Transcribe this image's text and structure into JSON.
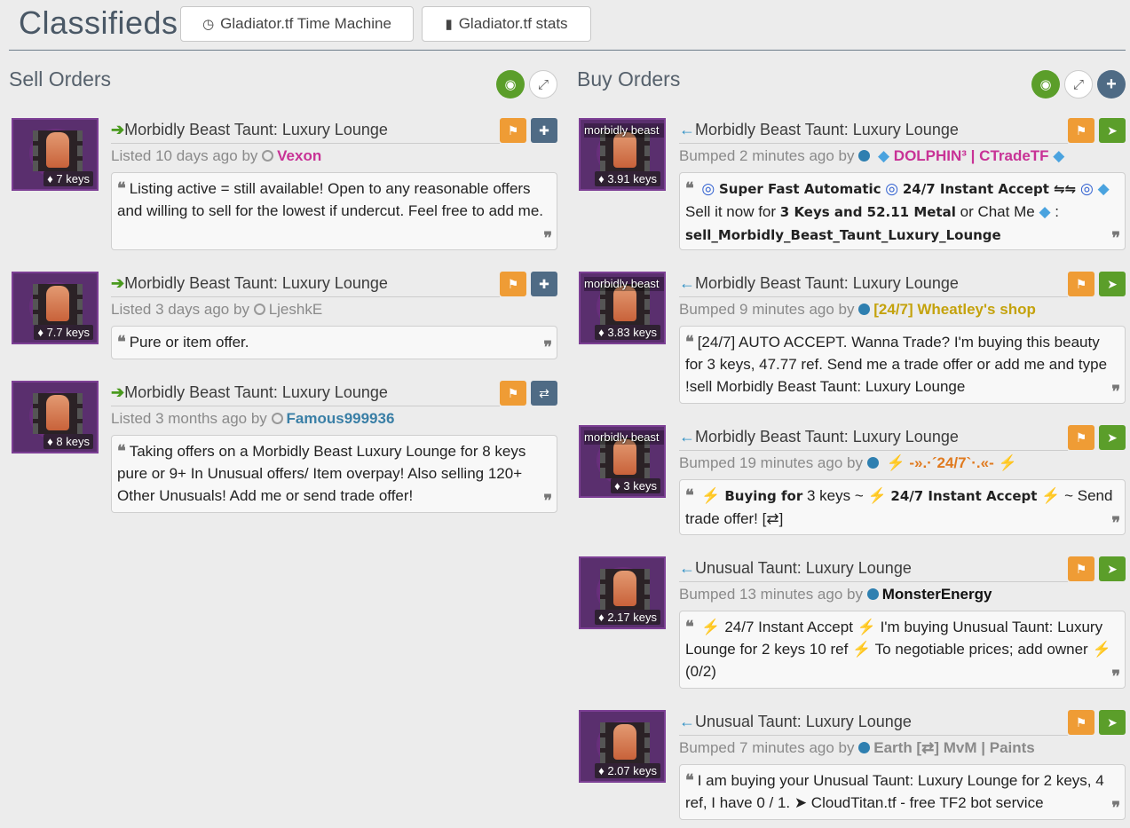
{
  "header": {
    "title": "Classifieds",
    "time_machine_label": "Gladiator.tf Time Machine",
    "stats_label": "Gladiator.tf stats"
  },
  "sell": {
    "title": "Sell Orders",
    "listings": [
      {
        "item_name": "Morbidly Beast Taunt: Luxury Lounge",
        "price": "7 keys",
        "listed": "Listed 10 days ago by",
        "user": "Vexon",
        "user_color": "#c83296",
        "description": "Listing active = still available! Open to any reasonable offers and willing to sell for the lowest if undercut. Feel free to add me."
      },
      {
        "item_name": "Morbidly Beast Taunt: Luxury Lounge",
        "price": "7.7 keys",
        "listed": "Listed 3 days ago by",
        "user": "LjeshkE",
        "user_color": "#8a8a8a",
        "description": "Pure or item offer."
      },
      {
        "item_name": "Morbidly Beast Taunt: Luxury Lounge",
        "price": "8 keys",
        "listed": "Listed 3 months ago by",
        "user": "Famous999936",
        "user_color": "#3a7fa6",
        "description": "Taking offers on a Morbidly Beast Luxury Lounge for 8 keys pure or 9+ In Unusual offers/ Item overpay! Also selling 120+ Other Unusuals! Add me or send trade offer!"
      }
    ]
  },
  "buy": {
    "title": "Buy Orders",
    "listings": [
      {
        "item_name": "Morbidly Beast Taunt: Luxury Lounge",
        "image_label": "morbidly beast",
        "price": "3.91 keys",
        "listed": "Bumped 2 minutes ago by",
        "user": "DOLPHIN³ | CTradeTF",
        "user_color": "#c83296",
        "d_a": "Super Fast Automatic",
        "d_b": "24/7 Instant Accept ⇋⇋",
        "d_c": "Sell it now for",
        "d_d": "3 Keys and 52.11 Metal",
        "d_e": "or Chat Me",
        "d_f": ":",
        "d_g": "sell_Morbidly_Beast_Taunt_Luxury_Lounge"
      },
      {
        "item_name": "Morbidly Beast Taunt: Luxury Lounge",
        "image_label": "morbidly beast",
        "price": "3.83 keys",
        "listed": "Bumped 9 minutes ago by",
        "user": "[24/7] Wheatley's shop",
        "user_color": "#c4a20c",
        "description": "[24/7] AUTO ACCEPT. Wanna Trade? I'm buying this beauty for 3 keys, 47.77 ref. Send me a trade offer or add me and type !sell Morbidly Beast Taunt: Luxury Lounge"
      },
      {
        "item_name": "Morbidly Beast Taunt: Luxury Lounge",
        "image_label": "morbidly beast",
        "price": "3 keys",
        "listed": "Bumped 19 minutes ago by",
        "user": "-».·´24/7`·.«-",
        "user_color": "#e07a1f",
        "d_a": "Buying for",
        "d_b": "3 keys ~",
        "d_c": "24/7 Instant Accept",
        "d_d": "~ Send trade offer! [⇄]"
      },
      {
        "item_name": "Unusual Taunt: Luxury Lounge",
        "price": "2.17 keys",
        "listed": "Bumped 13 minutes ago by",
        "user": "MonsterEnergy",
        "user_color": "#111111",
        "d_a": "24/7 Instant Accept",
        "d_b": "I'm buying Unusual Taunt: Luxury Lounge for 2 keys 10 ref",
        "d_c": "To negotiable prices; add owner",
        "d_d": "(0/2)"
      },
      {
        "item_name": "Unusual Taunt: Luxury Lounge",
        "price": "2.07 keys",
        "listed": "Bumped 7 minutes ago by",
        "user_a": "Earth [⇄] MvM",
        "user_sep": "|",
        "user_b": "Paints",
        "user_color": "#8a8a8a",
        "description": "I am buying your Unusual Taunt: Luxury Lounge for 2 keys, 4 ref, I have 0 / 1. ➤ CloudTitan.tf - free TF2 bot service"
      }
    ]
  },
  "glyphs": {
    "arrow_right": "🡒",
    "arrow_left": "🡐",
    "open_quote": "❝",
    "close_quote": "❞",
    "clock": "⏱",
    "stats": "📊",
    "tag": "🏷",
    "bolt": "⚡",
    "diamond": "🔹",
    "swirl": "🌀"
  }
}
